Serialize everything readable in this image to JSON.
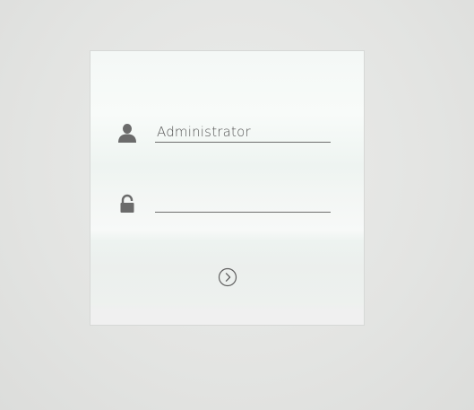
{
  "login": {
    "username": {
      "value": "Administrator",
      "placeholder": "",
      "icon": "user-icon"
    },
    "password": {
      "value": "",
      "placeholder": "",
      "icon": "lock-icon"
    },
    "submit": {
      "icon": "arrow-right-circle-icon"
    }
  },
  "colors": {
    "icon": "#6b6b6b",
    "input_text": "#555555",
    "underline": "#6e6e6e",
    "background": "#e4e5e4",
    "panel": "#f4f8f6"
  }
}
